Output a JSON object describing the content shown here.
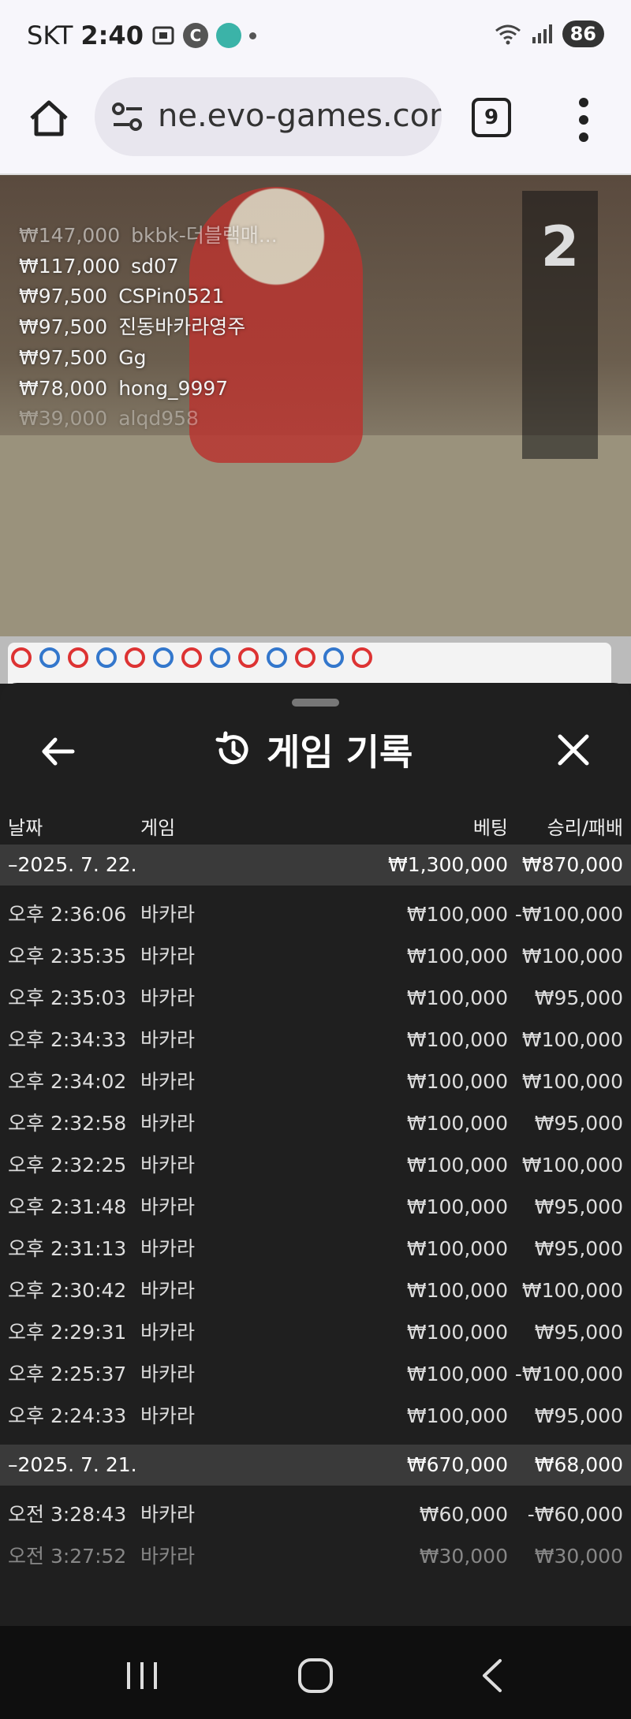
{
  "status": {
    "carrier": "SKT",
    "time": "2:40",
    "battery": "86"
  },
  "browser": {
    "url": "ne.evo-games.com",
    "tab_count": "9"
  },
  "stream": {
    "countdown": "2",
    "leaderboard": [
      {
        "amount": "₩147,000",
        "name": "bkbk-더블랙매..."
      },
      {
        "amount": "₩117,000",
        "name": "sd07"
      },
      {
        "amount": "₩97,500",
        "name": "CSPin0521"
      },
      {
        "amount": "₩97,500",
        "name": "진동바카라영주"
      },
      {
        "amount": "₩97,500",
        "name": "Gg"
      },
      {
        "amount": "₩78,000",
        "name": "hong_9997"
      },
      {
        "amount": "₩39,000",
        "name": "alqd958"
      }
    ]
  },
  "history": {
    "title": "게임 기록",
    "headers": {
      "date": "날짜",
      "game": "게임",
      "bet": "베팅",
      "result": "승리/패배"
    },
    "group1": {
      "date": "–2025. 7. 22.",
      "bet": "₩1,300,000",
      "result": "₩870,000"
    },
    "rows1": [
      {
        "time": "오후 2:36:06",
        "game": "바카라",
        "bet": "₩100,000",
        "result": "-₩100,000"
      },
      {
        "time": "오후 2:35:35",
        "game": "바카라",
        "bet": "₩100,000",
        "result": "₩100,000"
      },
      {
        "time": "오후 2:35:03",
        "game": "바카라",
        "bet": "₩100,000",
        "result": "₩95,000"
      },
      {
        "time": "오후 2:34:33",
        "game": "바카라",
        "bet": "₩100,000",
        "result": "₩100,000"
      },
      {
        "time": "오후 2:34:02",
        "game": "바카라",
        "bet": "₩100,000",
        "result": "₩100,000"
      },
      {
        "time": "오후 2:32:58",
        "game": "바카라",
        "bet": "₩100,000",
        "result": "₩95,000"
      },
      {
        "time": "오후 2:32:25",
        "game": "바카라",
        "bet": "₩100,000",
        "result": "₩100,000"
      },
      {
        "time": "오후 2:31:48",
        "game": "바카라",
        "bet": "₩100,000",
        "result": "₩95,000"
      },
      {
        "time": "오후 2:31:13",
        "game": "바카라",
        "bet": "₩100,000",
        "result": "₩95,000"
      },
      {
        "time": "오후 2:30:42",
        "game": "바카라",
        "bet": "₩100,000",
        "result": "₩100,000"
      },
      {
        "time": "오후 2:29:31",
        "game": "바카라",
        "bet": "₩100,000",
        "result": "₩95,000"
      },
      {
        "time": "오후 2:25:37",
        "game": "바카라",
        "bet": "₩100,000",
        "result": "-₩100,000"
      },
      {
        "time": "오후 2:24:33",
        "game": "바카라",
        "bet": "₩100,000",
        "result": "₩95,000"
      }
    ],
    "group2": {
      "date": "–2025. 7. 21.",
      "bet": "₩670,000",
      "result": "₩68,000"
    },
    "rows2": [
      {
        "time": "오전 3:28:43",
        "game": "바카라",
        "bet": "₩60,000",
        "result": "-₩60,000"
      },
      {
        "time": "오전 3:27:52",
        "game": "바카라",
        "bet": "₩30,000",
        "result": "₩30,000"
      }
    ]
  }
}
